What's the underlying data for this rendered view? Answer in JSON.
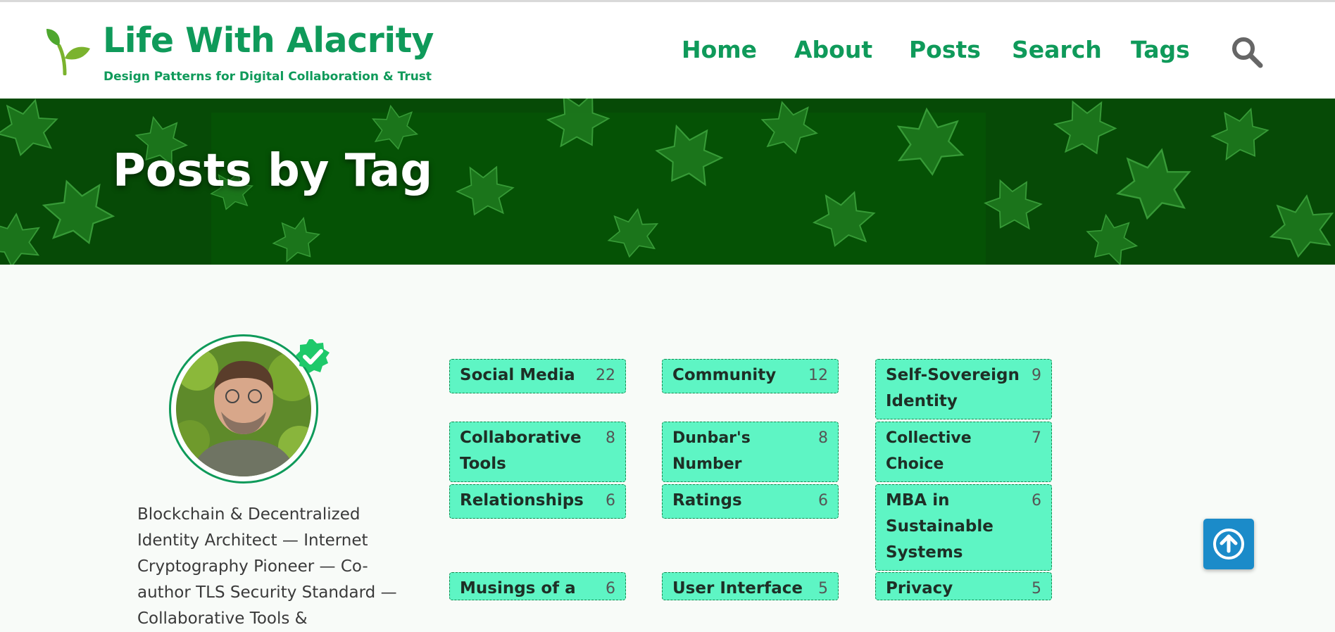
{
  "header": {
    "site_title": "Life With Alacrity",
    "site_subtitle": "Design Patterns for Digital Collaboration & Trust",
    "logo_icon": "sprout-icon",
    "nav": [
      {
        "label": "Home"
      },
      {
        "label": "About"
      },
      {
        "label": "Posts"
      },
      {
        "label": "Search"
      },
      {
        "label": "Tags"
      }
    ],
    "search_icon": "magnifier-icon"
  },
  "hero": {
    "title": "Posts by Tag"
  },
  "profile": {
    "bio": "Blockchain & Decentralized Identity Architect — Internet Cryptography Pioneer — Co-author TLS Security Standard — Collaborative Tools &"
  },
  "tags": [
    {
      "name": "Social Media",
      "count": "22"
    },
    {
      "name": "Community",
      "count": "12"
    },
    {
      "name": "Self-Sovereign Identity",
      "count": "9"
    },
    {
      "name": "Collaborative Tools",
      "count": "8"
    },
    {
      "name": "Dunbar's Number",
      "count": "8"
    },
    {
      "name": "Collective Choice",
      "count": "7"
    },
    {
      "name": "Relationships",
      "count": "6"
    },
    {
      "name": "Ratings",
      "count": "6"
    },
    {
      "name": "MBA in Sustainable Systems",
      "count": "6"
    },
    {
      "name": "Musings of a",
      "count": "6"
    },
    {
      "name": "User Interface",
      "count": "5"
    },
    {
      "name": "Privacy",
      "count": "5"
    }
  ],
  "colors": {
    "brand_green": "#0f9a5a",
    "tag_background": "#5ef5c4",
    "hero_green": "#064a06",
    "back_to_top": "#1b8bc9"
  }
}
